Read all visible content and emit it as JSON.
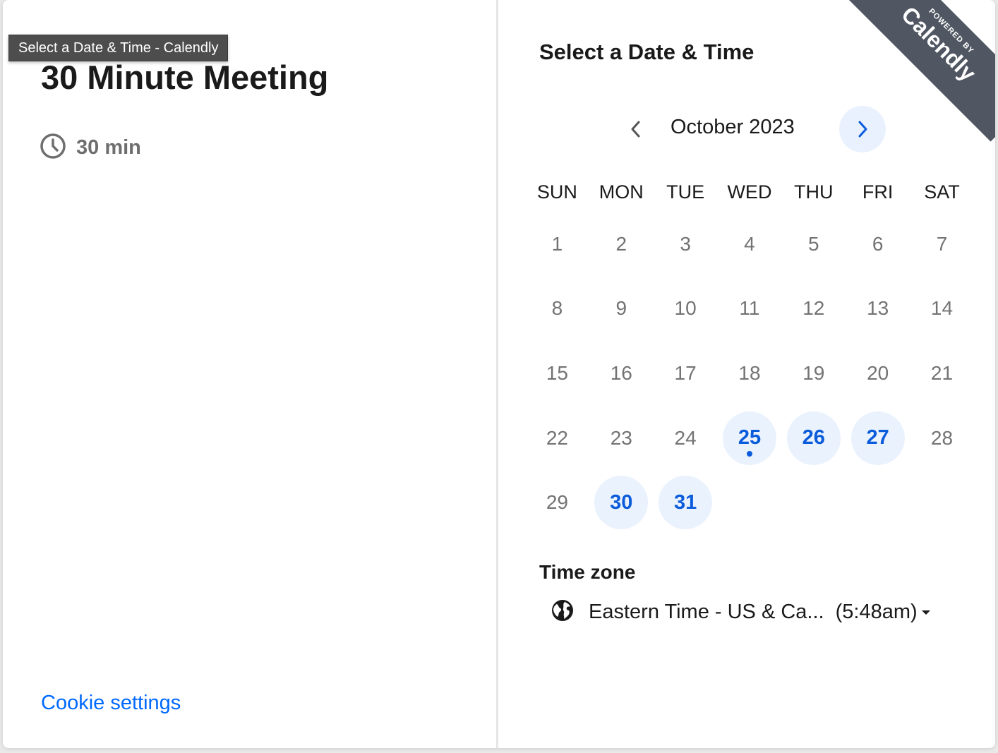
{
  "tooltip": {
    "text": "Select a Date & Time - Calendly"
  },
  "event": {
    "title": "30 Minute Meeting",
    "duration": "30 min",
    "duration_icon": "clock-icon"
  },
  "footer": {
    "cookie_link": "Cookie settings"
  },
  "scheduler": {
    "title": "Select a Date & Time",
    "month_label": "October 2023",
    "prev_icon": "chevron-left-icon",
    "next_icon": "chevron-right-icon",
    "weekdays": [
      "SUN",
      "MON",
      "TUE",
      "WED",
      "THU",
      "FRI",
      "SAT"
    ],
    "days": [
      "1",
      "2",
      "3",
      "4",
      "5",
      "6",
      "7",
      "8",
      "9",
      "10",
      "11",
      "12",
      "13",
      "14",
      "15",
      "16",
      "17",
      "18",
      "19",
      "20",
      "21",
      "22",
      "23",
      "24",
      "25",
      "26",
      "27",
      "28",
      "29",
      "30",
      "31"
    ],
    "available_days": [
      "25",
      "26",
      "27",
      "30",
      "31"
    ],
    "today": "25"
  },
  "timezone": {
    "title": "Time zone",
    "icon": "globe-icon",
    "name": "Eastern Time - US & Ca...",
    "current_time": "(5:48am)"
  },
  "branding": {
    "powered_by": "POWERED BY",
    "brand": "Calendly"
  },
  "colors": {
    "accent": "#0069ff",
    "available_bg": "#eaf2fe",
    "available_text": "#0b5cdb",
    "ribbon": "#505762"
  }
}
